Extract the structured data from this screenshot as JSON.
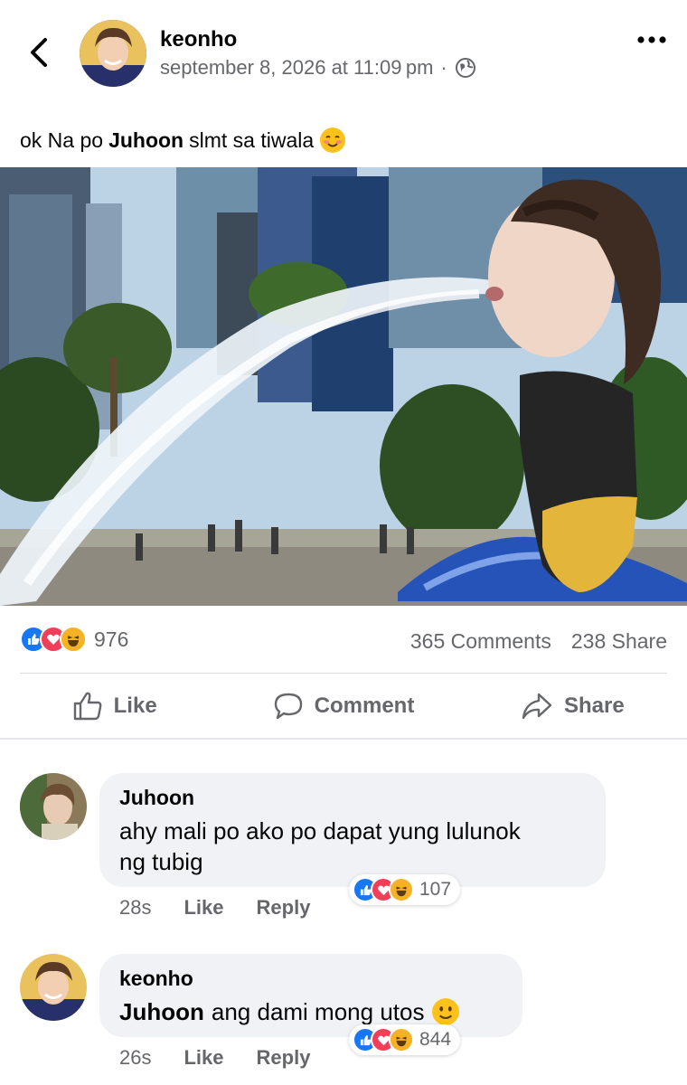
{
  "post": {
    "author": "keonho",
    "timestamp": "september 8, 2026 at 11:09 pm",
    "visibility_icon": "globe-icon",
    "caption_pre": "ok Na po",
    "caption_mention": "Juhoon",
    "caption_post": "slmt sa tiwala",
    "caption_emoji": "smiling-face-emoji"
  },
  "stats": {
    "reactions": [
      "like",
      "love",
      "haha"
    ],
    "reaction_count": "976",
    "comments": "365 Comments",
    "shares": "238 Share"
  },
  "actions": {
    "like": "Like",
    "comment": "Comment",
    "share": "Share"
  },
  "comments": [
    {
      "author": "Juhoon",
      "text_line1": "ahy mali po ako po dapat yung lulunok",
      "text_line2": "ng tubig",
      "time": "28s",
      "like": "Like",
      "reply": "Reply",
      "reaction_count": "107"
    },
    {
      "author": "keonho",
      "mention": "Juhoon",
      "text": "ang dami mong utos",
      "emoji": "slightly-smiling-face-emoji",
      "time": "26s",
      "like": "Like",
      "reply": "Reply",
      "reaction_count": "844"
    }
  ],
  "colors": {
    "like_blue": "#1877f2",
    "love_red": "#f33e58",
    "haha_yellow": "#f7b125",
    "secondary_text": "#65676b",
    "bubble_bg": "#f0f2f5"
  }
}
